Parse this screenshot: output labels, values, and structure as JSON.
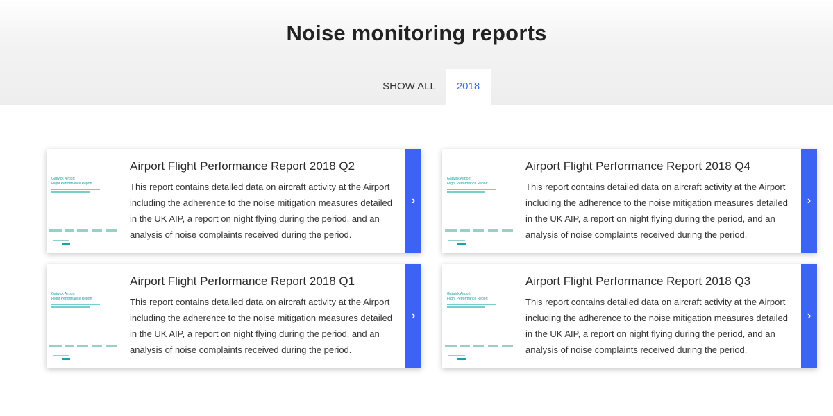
{
  "page": {
    "title": "Noise monitoring reports"
  },
  "tabs": [
    {
      "label": "SHOW ALL",
      "active": false
    },
    {
      "label": "2018",
      "active": true
    }
  ],
  "colors": {
    "accent": "#3d63f5",
    "tab_active_text": "#3a6fe6",
    "thumbnail_teal": "#1aa3a3"
  },
  "reports": [
    {
      "title": "Airport Flight Performance Report 2018 Q2",
      "description": "This report contains detailed data on aircraft activity at the Airport including the adherence to the noise mitigation measures detailed in the UK AIP, a report on night flying during the period, and an analysis of noise complaints received during the period.",
      "thumb_brand": "Gatwick Airport",
      "thumb_title": "Flight Performance Report",
      "arrow_icon": "chevron-right-icon"
    },
    {
      "title": "Airport Flight Performance Report 2018 Q4",
      "description": "This report contains detailed data on aircraft activity at the Airport including the adherence to the noise mitigation measures detailed in the UK AIP, a report on night flying during the period, and an analysis of noise complaints received during the period.",
      "thumb_brand": "Gatwick Airport",
      "thumb_title": "Flight Performance Report",
      "arrow_icon": "chevron-right-icon"
    },
    {
      "title": "Airport Flight Performance Report 2018 Q1",
      "description": "This report contains detailed data on aircraft activity at the Airport including the adherence to the noise mitigation measures detailed in the UK AIP, a report on night flying during the period, and an analysis of noise complaints received during the period.",
      "thumb_brand": "Gatwick Airport",
      "thumb_title": "Flight Performance Report",
      "arrow_icon": "chevron-right-icon"
    },
    {
      "title": "Airport Flight Performance Report 2018 Q3",
      "description": "This report contains detailed data on aircraft activity at the Airport including the adherence to the noise mitigation measures detailed in the UK AIP, a report on night flying during the period, and an analysis of noise complaints received during the period.",
      "thumb_brand": "Gatwick Airport",
      "thumb_title": "Flight Performance Report",
      "arrow_icon": "chevron-right-icon"
    }
  ]
}
